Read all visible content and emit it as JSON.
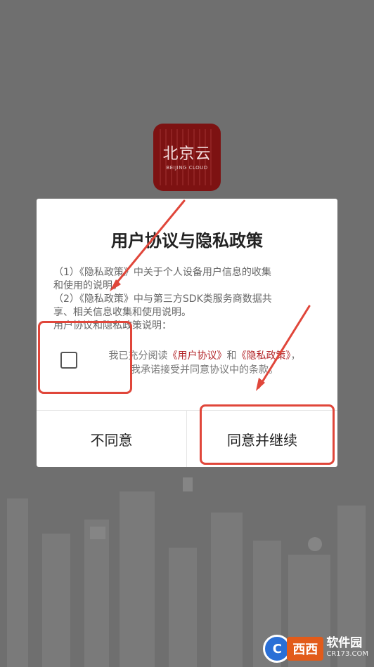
{
  "app": {
    "logo_title": "北京云",
    "logo_subtitle": "BEIJING CLOUD",
    "brand_color": "#7d1212"
  },
  "dialog": {
    "title": "用户协议与隐私政策",
    "policy_lines": [
      "（1）《隐私政策》中关于个人设备用户信息的收集",
      "和使用的说明。",
      "（2）《隐私政策》中与第三方SDK类服务商数据共",
      "享、相关信息收集和使用说明。",
      "用户协议和隐私政策说明："
    ],
    "agreement": {
      "checked": false,
      "prefix": "我已充分阅读",
      "user_agreement_link": "《用户协议》",
      "and": "和",
      "privacy_link": "《隐私政策》",
      "comma": "，",
      "line2": "我承诺接受并同意协议中的条款。",
      "link_color": "#b3262a"
    },
    "buttons": {
      "disagree": "不同意",
      "agree": "同意并继续"
    }
  },
  "annotation_color": "#e0463a",
  "watermark": {
    "brand": "西西",
    "text": "软件园",
    "url": "CR173.COM"
  }
}
